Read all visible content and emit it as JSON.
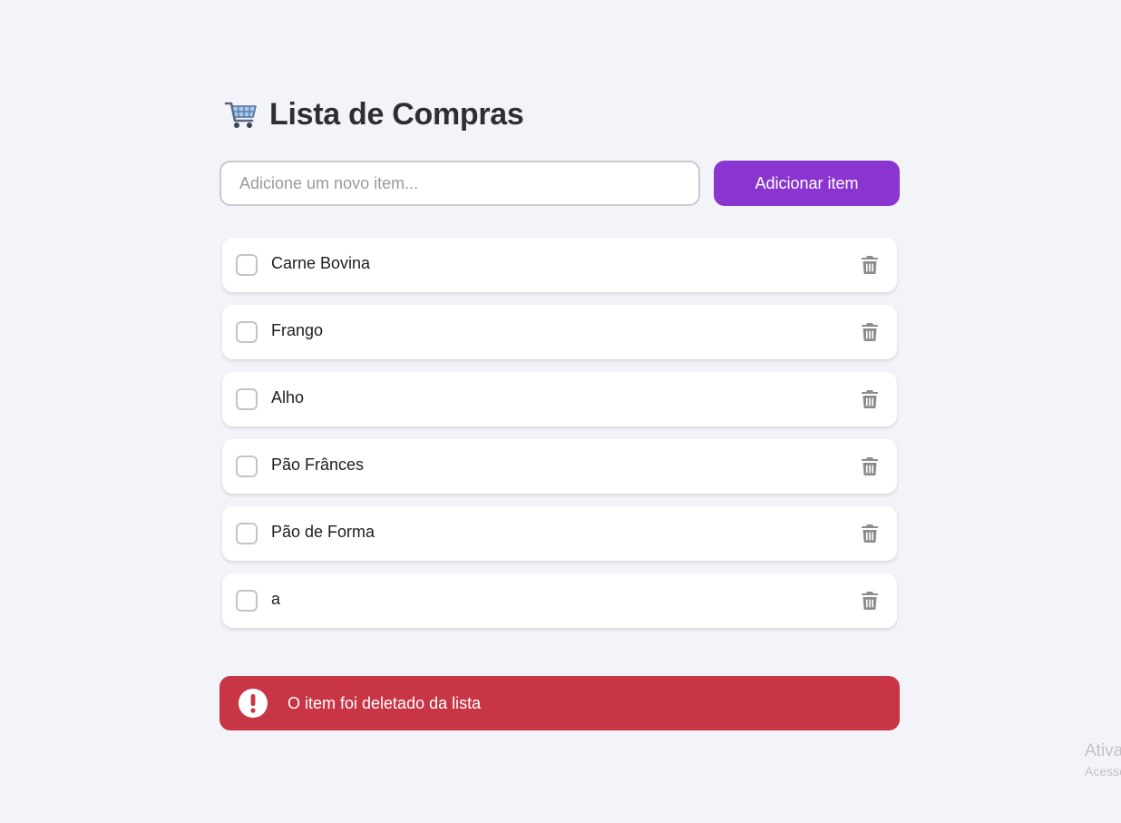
{
  "header": {
    "title": "Lista de Compras",
    "icon": "shopping-cart-icon"
  },
  "add_form": {
    "placeholder": "Adicione um novo item...",
    "value": "",
    "button_label": "Adicionar item"
  },
  "items": [
    {
      "label": "Carne Bovina",
      "checked": false
    },
    {
      "label": "Frango",
      "checked": false
    },
    {
      "label": "Alho",
      "checked": false
    },
    {
      "label": "Pão Frânces",
      "checked": false
    },
    {
      "label": "Pão de Forma",
      "checked": false
    },
    {
      "label": "a",
      "checked": false
    }
  ],
  "toast": {
    "message": "O item foi deletado da lista",
    "icon": "exclamation-circle-icon"
  },
  "watermark": {
    "title": "Ativa",
    "subtitle": "Acesse"
  },
  "colors": {
    "background": "#f3f4f9",
    "accent": "#8a35cf",
    "toast": "#c83646",
    "trash": "#8c8c90"
  }
}
